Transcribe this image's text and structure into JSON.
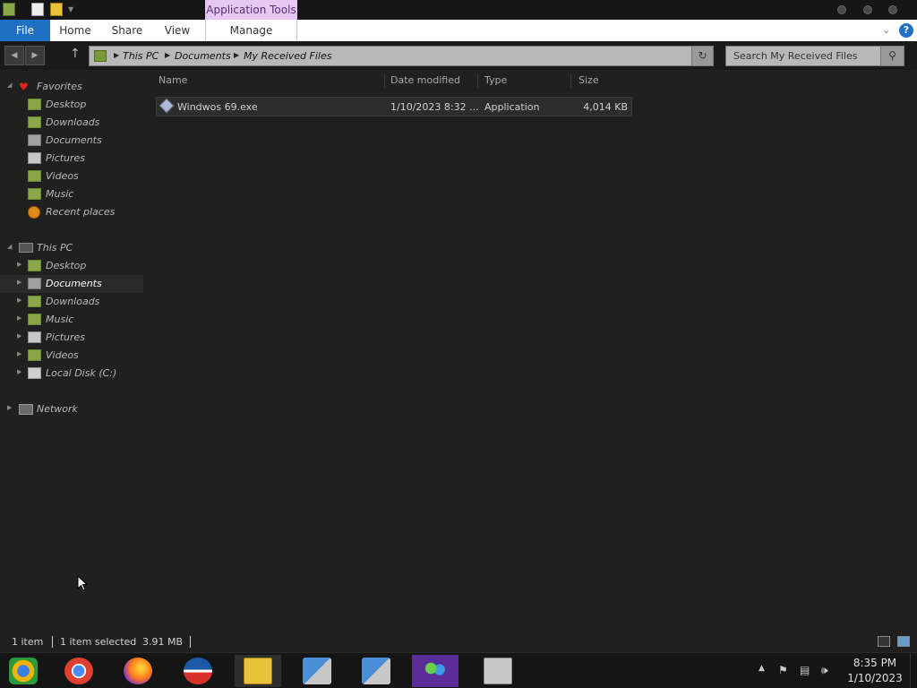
{
  "titlebar": {
    "contextual_tab": "Application Tools"
  },
  "ribbon": {
    "file": "File",
    "home": "Home",
    "share": "Share",
    "view": "View",
    "manage": "Manage"
  },
  "address": {
    "crumbs": [
      "This PC",
      "Documents",
      "My Received Files"
    ],
    "search_placeholder": "Search My Received Files"
  },
  "nav": {
    "favorites": {
      "label": "Favorites",
      "items": [
        "Desktop",
        "Downloads",
        "Documents",
        "Pictures",
        "Videos",
        "Music",
        "Recent places"
      ]
    },
    "this_pc": {
      "label": "This PC",
      "items": [
        "Desktop",
        "Documents",
        "Downloads",
        "Music",
        "Pictures",
        "Videos",
        "Local Disk (C:)"
      ],
      "selected": "Documents"
    },
    "network": "Network"
  },
  "files": {
    "columns": [
      "Name",
      "Date modified",
      "Type",
      "Size"
    ],
    "rows": [
      {
        "name": "Windwos 69.exe",
        "date": "1/10/2023 8:32 ...",
        "type": "Application",
        "size": "4,014 KB"
      }
    ]
  },
  "status": {
    "count": "1 item",
    "selected": "1 item selected",
    "size": "3.91 MB"
  },
  "taskbar": {
    "apps": [
      "chrome-canary",
      "chrome",
      "firefox",
      "obama-logo",
      "file-explorer",
      "network-installer-1",
      "network-installer-2",
      "windows-live-messenger",
      "archive-app"
    ],
    "time": "8:35 PM",
    "date": "1/10/2023"
  },
  "colors": {
    "accent": "#1f6fc5",
    "contextual_tab": "#e6c8f2",
    "background": "#202020"
  }
}
